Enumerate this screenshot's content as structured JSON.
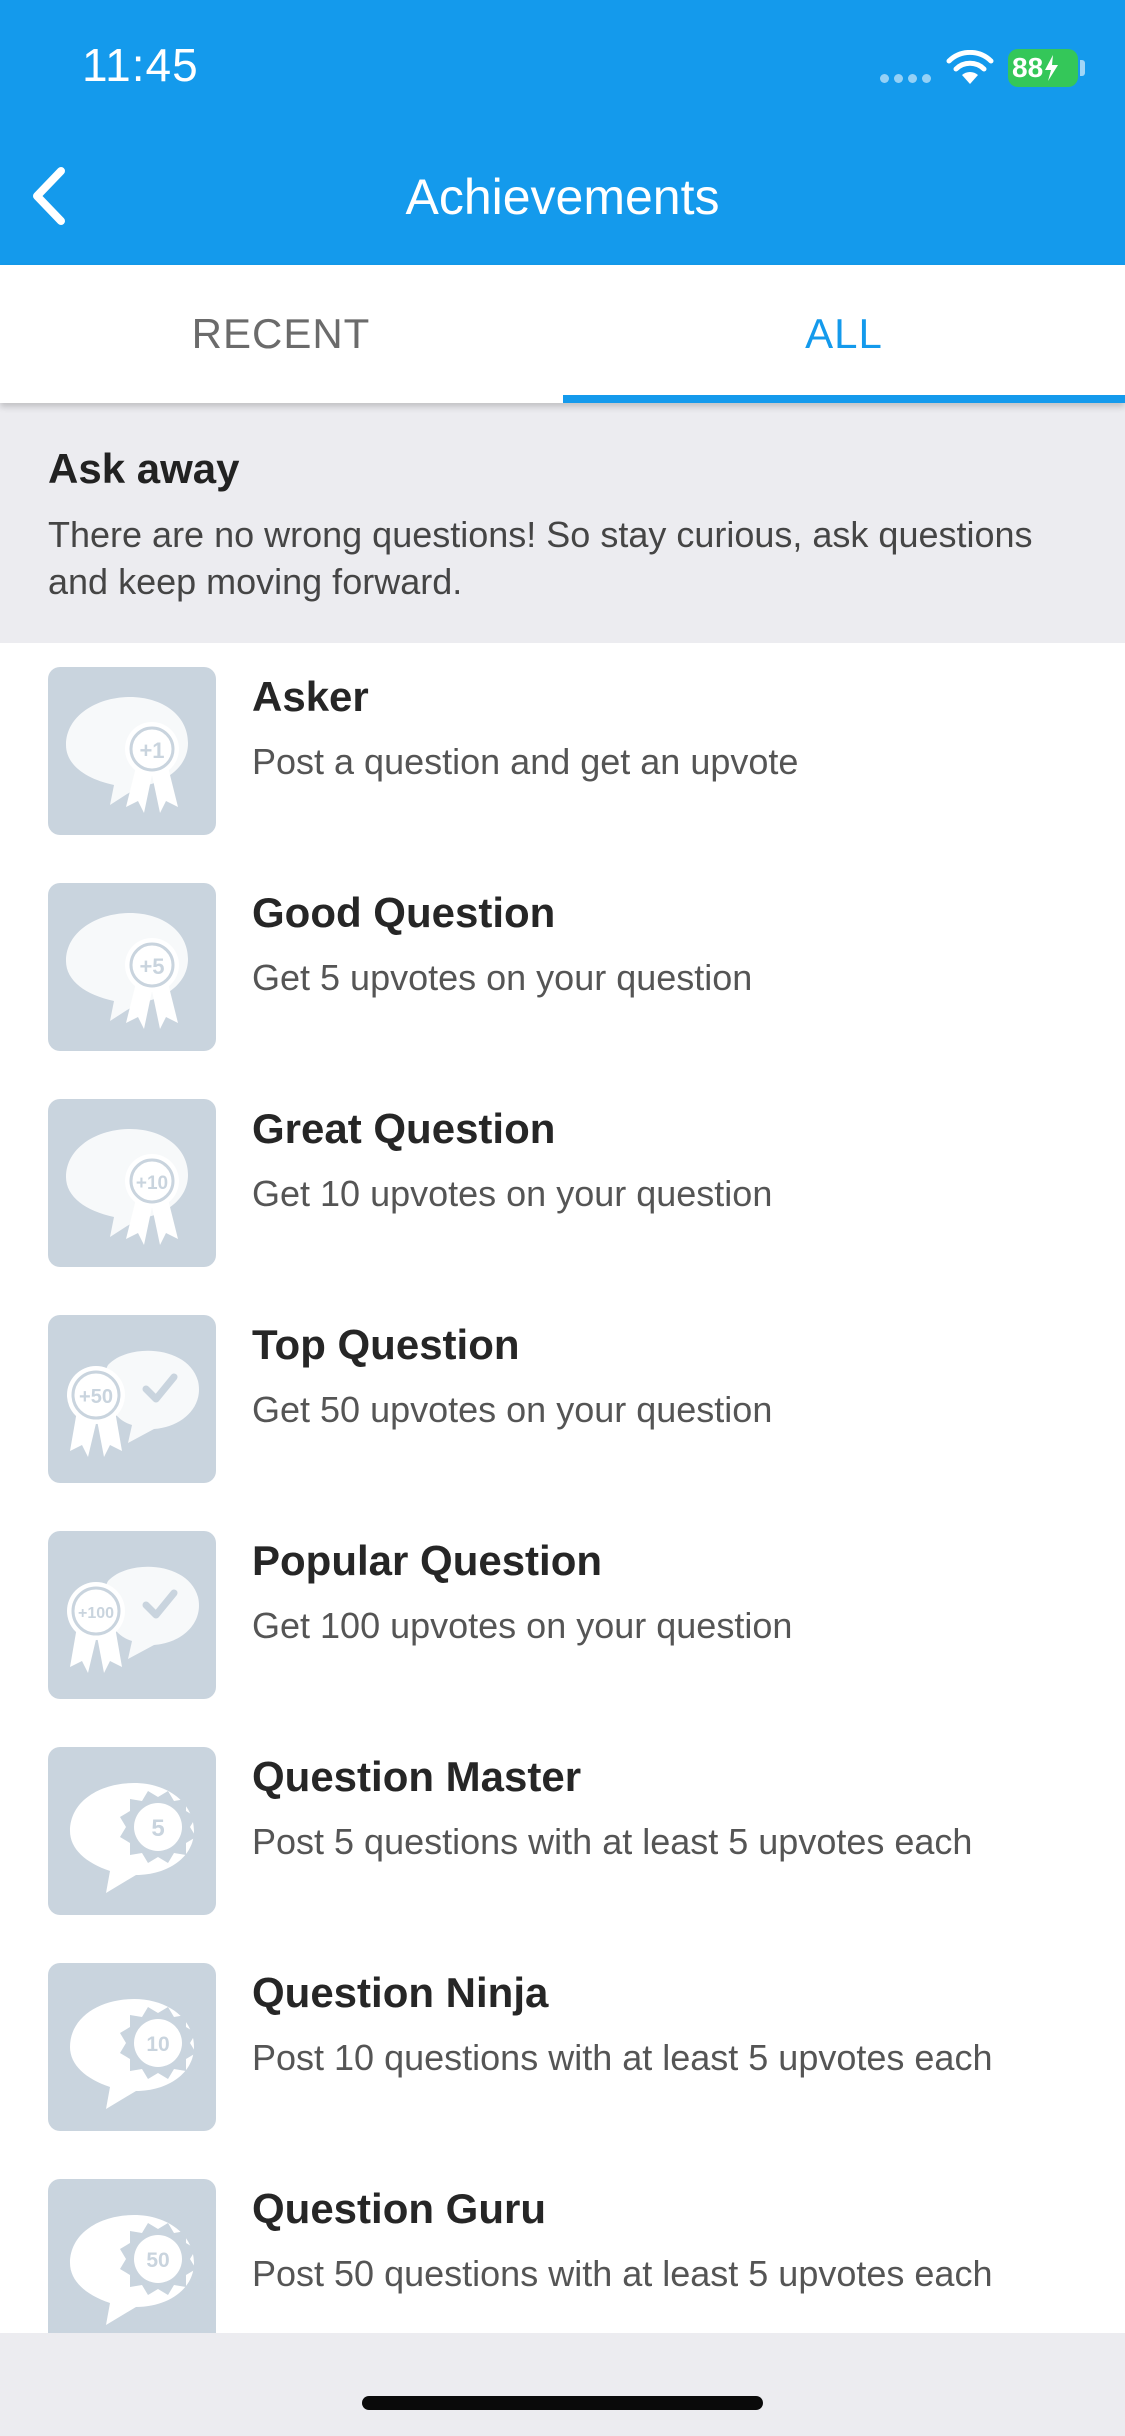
{
  "status_bar": {
    "time": "11:45",
    "battery": "88"
  },
  "nav": {
    "title": "Achievements",
    "back_icon": "chevron-left-icon"
  },
  "tabs": [
    {
      "label": "RECENT",
      "selected": false
    },
    {
      "label": "ALL",
      "selected": true
    }
  ],
  "section": {
    "title": "Ask away",
    "description": "There are no wrong questions! So stay curious, ask questions and keep moving forward."
  },
  "achievements": [
    {
      "title": "Asker",
      "description": "Post a question and get an upvote",
      "badge_text": "+1",
      "icon": "ribbon-badge-icon"
    },
    {
      "title": "Good Question",
      "description": "Get 5 upvotes on your question",
      "badge_text": "+5",
      "icon": "ribbon-badge-icon"
    },
    {
      "title": "Great Question",
      "description": "Get 10 upvotes on your question",
      "badge_text": "+10",
      "icon": "ribbon-badge-icon"
    },
    {
      "title": "Top Question",
      "description": "Get 50 upvotes on your question",
      "badge_text": "+50",
      "icon": "double-ribbon-check-icon"
    },
    {
      "title": "Popular Question",
      "description": "Get 100 upvotes on your question",
      "badge_text": "+100",
      "icon": "double-ribbon-check-icon"
    },
    {
      "title": "Question Master",
      "description": "Post 5 questions with at least 5 upvotes each",
      "badge_text": "5",
      "icon": "speech-bubble-seal-icon"
    },
    {
      "title": "Question Ninja",
      "description": "Post 10 questions with at least 5 upvotes each",
      "badge_text": "10",
      "icon": "speech-bubble-seal-icon"
    },
    {
      "title": "Question Guru",
      "description": "Post 50 questions with at least 5 upvotes each",
      "badge_text": "50",
      "icon": "speech-bubble-seal-icon"
    }
  ],
  "colors": {
    "brand": "#149aec",
    "badge_bg": "#c9d4de",
    "battery": "#34c759"
  }
}
